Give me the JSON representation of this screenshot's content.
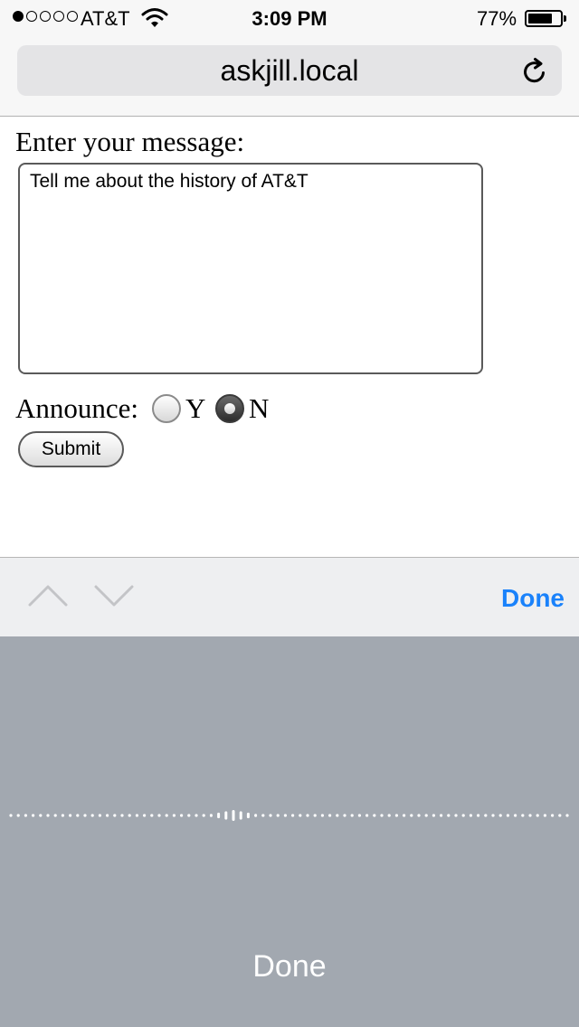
{
  "status_bar": {
    "signal_dots_filled": 1,
    "signal_dots_total": 5,
    "carrier": "AT&T",
    "wifi_icon": "wifi-icon",
    "time": "3:09 PM",
    "battery_percent": "77%",
    "battery_level": 0.77
  },
  "browser": {
    "url": "askjill.local",
    "reload_icon": "reload-icon"
  },
  "form": {
    "message_label": "Enter your message:",
    "message_value": "Tell me about the history of AT&T",
    "announce_label": "Announce:",
    "options": [
      {
        "label": "Y",
        "selected": false
      },
      {
        "label": "N",
        "selected": true
      }
    ],
    "submit_label": "Submit"
  },
  "accessory_bar": {
    "prev_icon": "chevron-up-icon",
    "next_icon": "chevron-down-icon",
    "done_label": "Done",
    "accent_color": "#1a82fb"
  },
  "dictation": {
    "waveform_icon": "dictation-waveform-icon",
    "done_label": "Done",
    "background_color": "#a2a8b0"
  }
}
